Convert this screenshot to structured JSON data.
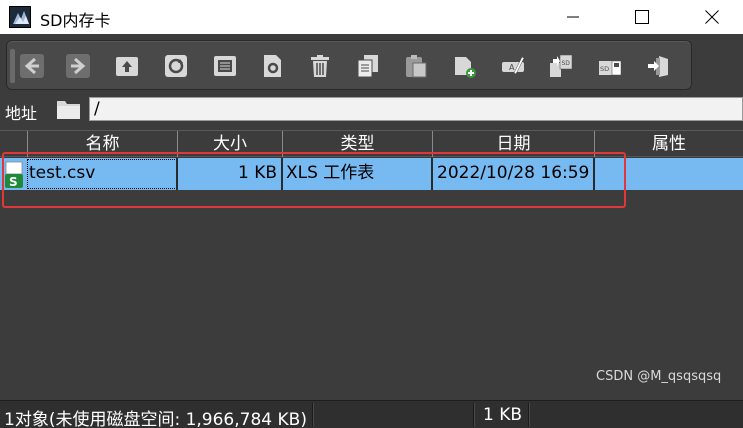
{
  "window": {
    "title": "SD内存卡"
  },
  "toolbar": {
    "buttons": [
      "back-icon",
      "forward-icon",
      "up-folder-icon",
      "refresh-icon",
      "view-icon",
      "properties-icon",
      "delete-icon",
      "copy-icon",
      "paste-icon",
      "new-folder-icon",
      "rename-icon",
      "sd-transfer-icon",
      "sd-save-icon",
      "exit-icon"
    ]
  },
  "address": {
    "label": "地址",
    "path": "/"
  },
  "table": {
    "columns": [
      "名称",
      "大小",
      "类型",
      "日期",
      "属性"
    ],
    "rows": [
      {
        "name": "test.csv",
        "size": "1 KB",
        "type": "XLS 工作表",
        "date": "2022/10/28 16:59",
        "attr": ""
      }
    ]
  },
  "status": {
    "objects": "1对象(未使用磁盘空间: 1,966,784 KB)",
    "size": "1 KB"
  },
  "watermark": "CSDN @M_qsqsqsq",
  "colors": {
    "selection": "#77baf2",
    "highlight_box": "#e0373a",
    "background": "#3c3c3c"
  }
}
